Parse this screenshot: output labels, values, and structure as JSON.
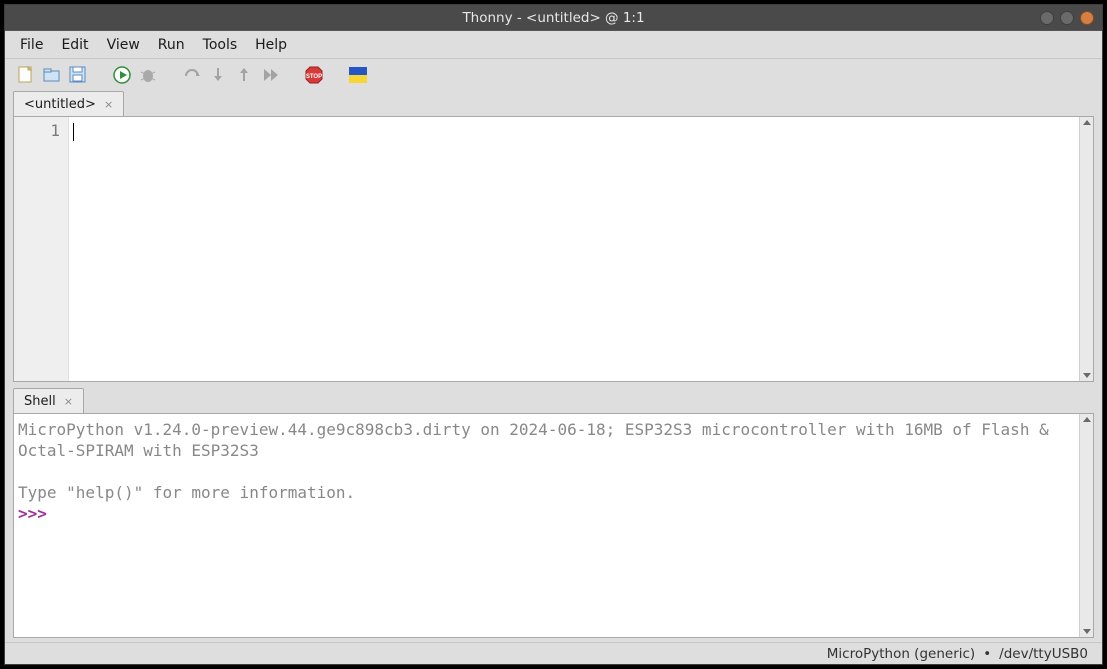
{
  "titlebar": {
    "title": "Thonny  -  <untitled>  @ 1:1"
  },
  "menu": {
    "file": "File",
    "edit": "Edit",
    "view": "View",
    "run": "Run",
    "tools": "Tools",
    "help": "Help"
  },
  "tabs": {
    "editor": {
      "label": "<untitled>"
    },
    "shell": {
      "label": "Shell"
    }
  },
  "editor": {
    "line_number": "1",
    "content": ""
  },
  "shell": {
    "banner_line1": "MicroPython v1.24.0-preview.44.ge9c898cb3.dirty on 2024-06-18; ESP32S3 microcontroller with 16MB of Flash & Octal-SPIRAM with ESP32S3",
    "banner_line2": "Type \"help()\" for more information.",
    "prompt": ">>> "
  },
  "statusbar": {
    "backend": "MicroPython (generic)",
    "sep": "•",
    "port": "/dev/ttyUSB0"
  }
}
